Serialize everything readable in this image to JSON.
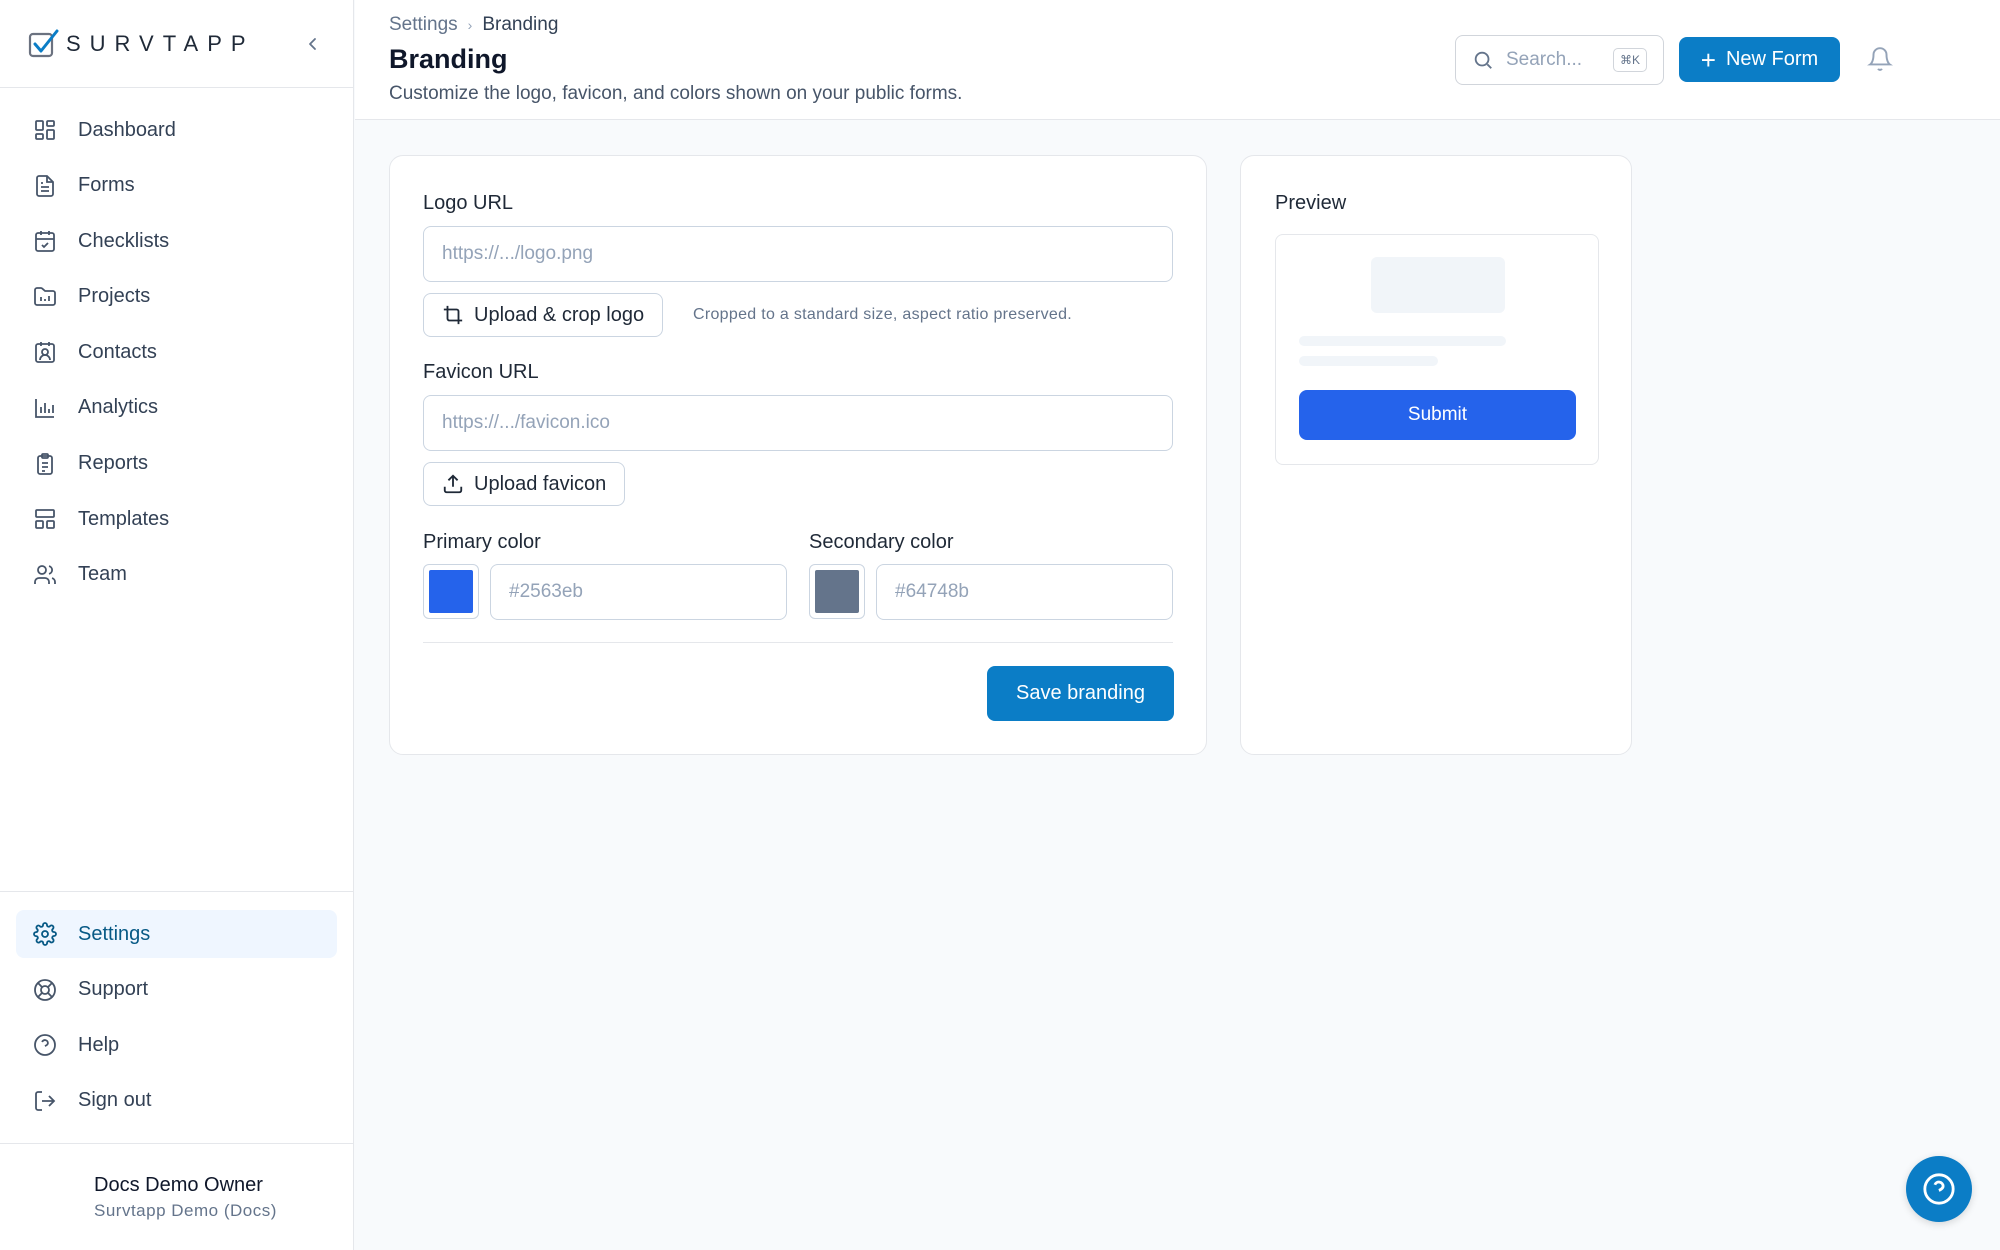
{
  "app": {
    "brand": "SURVTAPP"
  },
  "colors": {
    "accent": "#0b7dc6",
    "primary": "#2563eb",
    "secondary": "#64748b"
  },
  "sidebar": {
    "items": [
      {
        "label": "Dashboard",
        "icon": "dashboard-icon"
      },
      {
        "label": "Forms",
        "icon": "file-icon"
      },
      {
        "label": "Checklists",
        "icon": "calendar-check-icon"
      },
      {
        "label": "Projects",
        "icon": "folder-chart-icon"
      },
      {
        "label": "Contacts",
        "icon": "contact-card-icon"
      },
      {
        "label": "Analytics",
        "icon": "bar-chart-icon"
      },
      {
        "label": "Reports",
        "icon": "clipboard-icon"
      },
      {
        "label": "Templates",
        "icon": "layout-icon"
      },
      {
        "label": "Team",
        "icon": "users-icon"
      }
    ],
    "bottom_items": [
      {
        "label": "Settings",
        "icon": "gear-icon",
        "active": true
      },
      {
        "label": "Support",
        "icon": "lifebuoy-icon"
      },
      {
        "label": "Help",
        "icon": "help-circle-icon"
      },
      {
        "label": "Sign out",
        "icon": "sign-out-icon"
      }
    ],
    "user": {
      "name": "Docs Demo Owner",
      "org": "Survtapp Demo (Docs)"
    }
  },
  "header": {
    "breadcrumb": {
      "parent": "Settings",
      "current": "Branding"
    },
    "title": "Branding",
    "subtitle": "Customize the logo, favicon, and colors shown on your public forms.",
    "search": {
      "placeholder": "Search...",
      "shortcut": "⌘K"
    },
    "new_form_label": "New Form"
  },
  "branding_form": {
    "logo": {
      "label": "Logo URL",
      "placeholder": "https://.../logo.png",
      "upload_label": "Upload & crop logo",
      "hint": "Cropped to a standard size, aspect ratio preserved."
    },
    "favicon": {
      "label": "Favicon URL",
      "placeholder": "https://.../favicon.ico",
      "upload_label": "Upload favicon"
    },
    "primary_color": {
      "label": "Primary color",
      "placeholder": "#2563eb",
      "value": "#2563eb"
    },
    "secondary_color": {
      "label": "Secondary color",
      "placeholder": "#64748b",
      "value": "#64748b"
    },
    "save_label": "Save branding"
  },
  "preview": {
    "title": "Preview",
    "submit_label": "Submit"
  }
}
